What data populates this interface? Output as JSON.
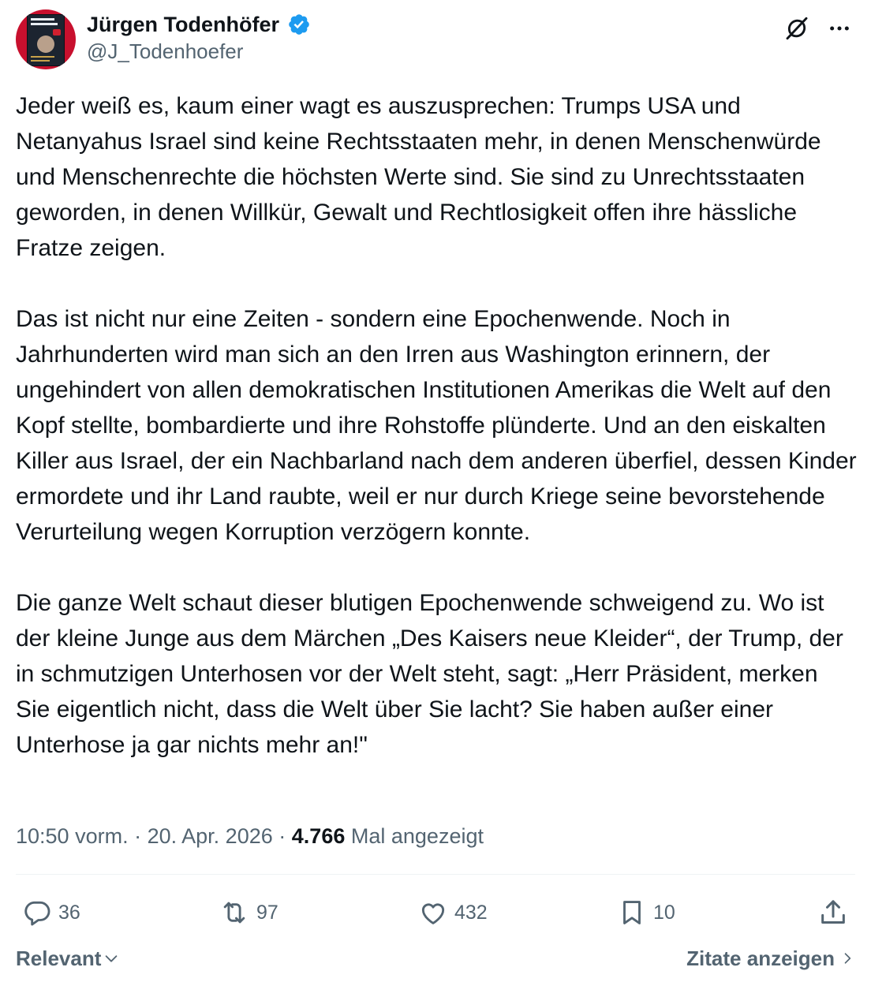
{
  "author": {
    "display_name": "Jürgen Todenhöfer",
    "handle": "@J_Todenhoefer",
    "verified": true,
    "verified_color": "#1d9bf0"
  },
  "header_icons": [
    "grok-icon",
    "more-icon"
  ],
  "tweet": {
    "text": "Jeder weiß es, kaum einer wagt es auszusprechen: Trumps USA und Netanyahus Israel sind keine Rechtsstaaten mehr, in denen Menschenwürde und Menschenrechte die höchsten Werte sind. Sie sind zu Unrechtsstaaten geworden, in denen Willkür, Gewalt und Rechtlosigkeit offen ihre hässliche Fratze zeigen.\n\nDas ist nicht nur eine Zeiten - sondern eine Epochenwende. Noch in Jahrhunderten wird man sich an den Irren aus Washington erinnern, der ungehindert von allen demokratischen Institutionen Amerikas die Welt auf den Kopf stellte, bombardierte und ihre Rohstoffe plünderte. Und an den eiskalten Killer aus Israel, der ein Nachbarland nach dem anderen überfiel, dessen Kinder ermordete und ihr Land raubte, weil er nur durch Kriege seine bevorstehende Verurteilung wegen Korruption verzögern konnte.\n\nDie ganze Welt schaut dieser blutigen Epochenwende schweigend zu. Wo ist der kleine Junge aus dem Märchen „Des Kaisers neue Kleider“, der Trump, der in schmutzigen Unterhosen vor der Welt steht, sagt: „Herr Präsident, merken Sie eigentlich nicht, dass die Welt über Sie lacht? Sie haben außer einer Unterhose ja gar nichts mehr an!\"",
    "time": "10:50 vorm.",
    "date": "20. Apr. 2026",
    "separator": "·",
    "views": "4.766",
    "views_label": "Mal angezeigt"
  },
  "actions": {
    "replies": "36",
    "reposts": "97",
    "likes": "432",
    "bookmarks": "10"
  },
  "footer": {
    "sort_label": "Relevant",
    "quotes_label": "Zitate anzeigen"
  }
}
